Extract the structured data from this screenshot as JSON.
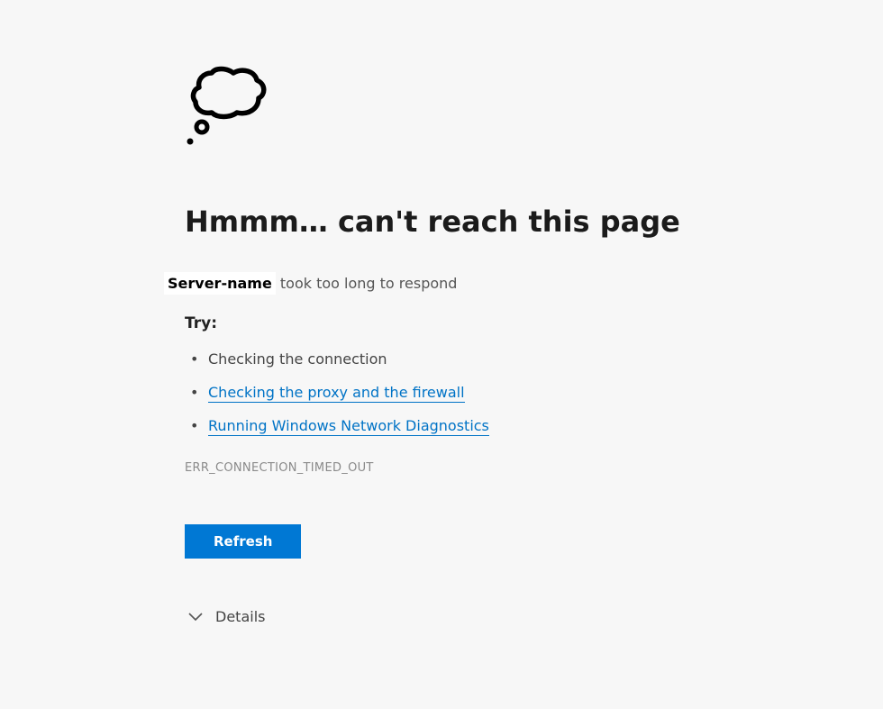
{
  "title": "Hmmm… can't reach this page",
  "server_name": "Server-name",
  "server_suffix": " took too long to respond",
  "try_label": "Try:",
  "suggestions": [
    {
      "text": "Checking the connection",
      "link": false
    },
    {
      "text": "Checking the proxy and the firewall",
      "link": true
    },
    {
      "text": "Running Windows Network Diagnostics",
      "link": true
    }
  ],
  "error_code": "ERR_CONNECTION_TIMED_OUT",
  "refresh_label": "Refresh",
  "details_label": "Details"
}
